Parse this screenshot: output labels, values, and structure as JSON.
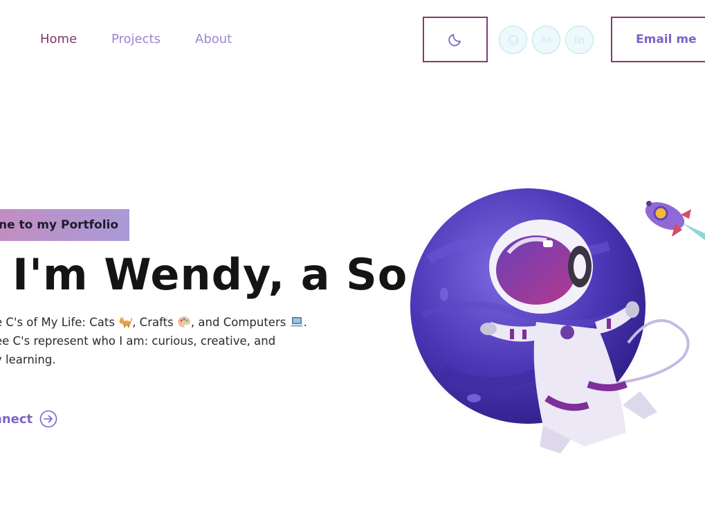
{
  "nav": {
    "home": "Home",
    "projects": "Projects",
    "about": "About"
  },
  "header": {
    "theme_icon": "moon-icon",
    "socials": [
      {
        "icon": "github-icon",
        "label": ""
      },
      {
        "icon": "behance-icon",
        "label": "Bē"
      },
      {
        "icon": "linkedin-icon",
        "label": "in"
      }
    ],
    "email_label": "Email me"
  },
  "hero": {
    "tagline": "ne to my Portfolio",
    "headline": "I'm Wendy, a So",
    "intro_line1_a": "e C's of My Life: Cats",
    "intro_line1_b": ", Crafts",
    "intro_line1_c": ", and Computers",
    "intro_line1_d": ".",
    "intro_line2": "ee C's represent who I am: curious, creative, and",
    "intro_line3": "y learning.",
    "connect_label": "nnect"
  },
  "colors": {
    "accent_purple": "#7b63c8",
    "accent_plum": "#87386c",
    "nav_inactive": "#9b85cf"
  }
}
